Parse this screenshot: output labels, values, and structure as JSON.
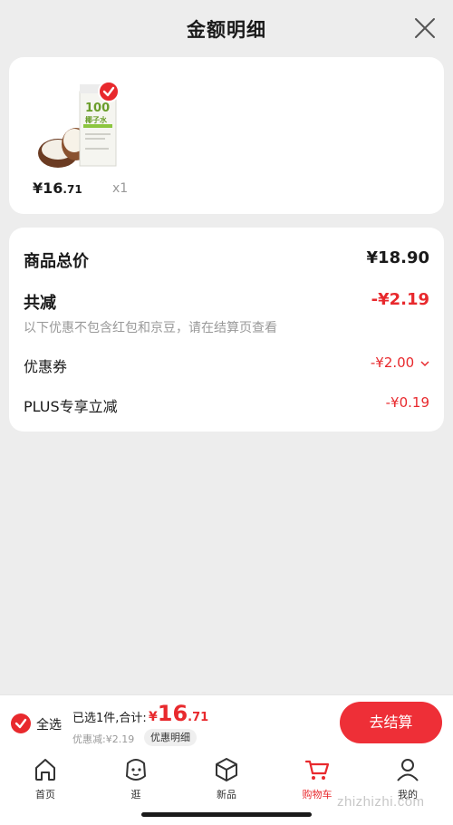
{
  "header": {
    "title": "金额明细"
  },
  "product": {
    "image_text": "100",
    "image_subtext": "椰子水",
    "price_symbol": "¥",
    "price_int": "16",
    "price_dec": ".71",
    "quantity": "x1"
  },
  "summary": {
    "total_label": "商品总价",
    "total_value": "¥18.90",
    "reduce_label": "共减",
    "reduce_value": "-¥2.19",
    "note": "以下优惠不包含红包和京豆，请在结算页查看",
    "coupon_label": "优惠券",
    "coupon_value": "-¥2.00",
    "plus_label": "PLUS专享立减",
    "plus_value": "-¥0.19"
  },
  "checkout": {
    "select_all": "全选",
    "selected_text": "已选1件,合计:",
    "total_symbol": "¥",
    "total_int": "16",
    "total_dec": ".71",
    "saved_text": "优惠减:¥2.19",
    "detail_chip": "优惠明细",
    "button": "去结算"
  },
  "tabs": [
    {
      "label": "首页",
      "icon": "home-icon"
    },
    {
      "label": "逛",
      "icon": "face-icon"
    },
    {
      "label": "新品",
      "icon": "box-icon"
    },
    {
      "label": "购物车",
      "icon": "cart-icon"
    },
    {
      "label": "我的",
      "icon": "person-icon"
    }
  ],
  "watermark": "zhizhizhi.com",
  "colors": {
    "accent": "#e8292d",
    "background": "#ededed",
    "card": "#ffffff"
  }
}
